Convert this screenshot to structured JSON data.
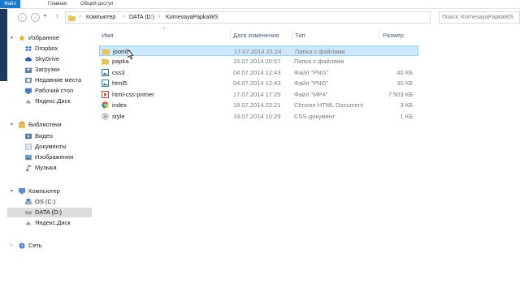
{
  "ribbon": {
    "file": "Файл",
    "home": "Главная",
    "share": "Общий доступ"
  },
  "nav": {
    "back": "←",
    "forward": "→",
    "dropdown": "▾",
    "up": "↑"
  },
  "address": {
    "crumbs": [
      "Компьютер",
      "DATA (D:)",
      "KornevayaPapkaWS"
    ],
    "separator": "›"
  },
  "search": {
    "placeholder": "Поиск: KornevayaPapkaWS"
  },
  "navpane": {
    "favorites": "Избранное",
    "fav_items": [
      "Dropbox",
      "SkyDrive",
      "Загрузки",
      "Недавние места",
      "Рабочий стол",
      "Яндекс.Диск"
    ],
    "libraries": "Библиотеки",
    "lib_items": [
      "Видео",
      "Документы",
      "Изображения",
      "Музыка"
    ],
    "computer": "Компьютер",
    "comp_items": [
      "OS (C:)",
      "DATA (D:)",
      "Яндекс.Диск"
    ],
    "network": "Сеть"
  },
  "columns": {
    "name": "Имя",
    "date": "Дата изменения",
    "type": "Тип",
    "size": "Размер"
  },
  "files": [
    {
      "name": "joomla",
      "date": "17.07.2014 21:24",
      "type": "Папка с файлами",
      "size": "",
      "icon": "folder-icon"
    },
    {
      "name": "papka",
      "date": "16.07.2014 20:57",
      "type": "Папка с файлами",
      "size": "",
      "icon": "folder-icon"
    },
    {
      "name": "css3",
      "date": "04.07.2014 12:43",
      "type": "Файл \"PNG\"",
      "size": "40 КБ",
      "icon": "image-file-icon"
    },
    {
      "name": "html5",
      "date": "04.07.2014 12:43",
      "type": "Файл \"PNG\"",
      "size": "30 КБ",
      "icon": "image-file-icon"
    },
    {
      "name": "html-css-primer",
      "date": "17.07.2014 17:25",
      "type": "Файл \"MP4\"",
      "size": "7 503 КБ",
      "icon": "video-file-icon"
    },
    {
      "name": "index",
      "date": "18.07.2014 22:21",
      "type": "Chrome HTML Document",
      "size": "3 КБ",
      "icon": "chrome-icon"
    },
    {
      "name": "style",
      "date": "19.07.2014 10:29",
      "type": "CSS-документ",
      "size": "1 КБ",
      "icon": "css-file-icon"
    }
  ],
  "colors": {
    "file_tab": "#1979ca",
    "selection": "#cce8ff",
    "selection_border": "#99d1ff",
    "folder": "#e8c25a"
  }
}
